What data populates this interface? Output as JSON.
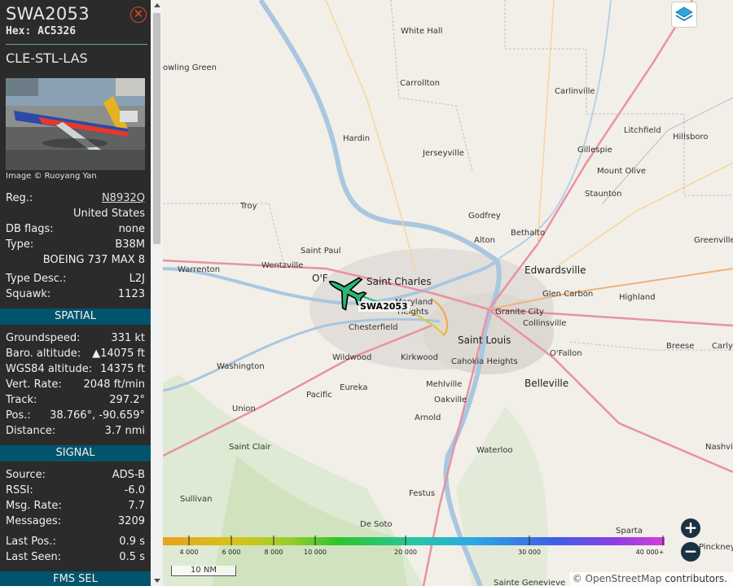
{
  "aircraft": {
    "callsign": "SWA2053",
    "hex_label": "Hex:",
    "hex": "AC5326",
    "route": "CLE-STL-LAS",
    "image_credit": "Image © Ruoyang Yan"
  },
  "details": {
    "reg_label": "Reg.:",
    "reg": "N8932Q",
    "country": "United States",
    "dbflags_label": "DB flags:",
    "dbflags": "none",
    "type_label": "Type:",
    "type": "B38M",
    "type_name": "BOEING 737 MAX 8",
    "typedesc_label": "Type Desc.:",
    "typedesc": "L2J",
    "squawk_label": "Squawk:",
    "squawk": "1123"
  },
  "spatial": {
    "header": "SPATIAL",
    "groundspeed_label": "Groundspeed:",
    "groundspeed": "331 kt",
    "baro_label": "Baro. altitude:",
    "baro_arrow": "▲",
    "baro": "14075 ft",
    "wgs84_label": "WGS84 altitude:",
    "wgs84": "14375 ft",
    "vrate_label": "Vert. Rate:",
    "vrate": "2048 ft/min",
    "track_label": "Track:",
    "track": "297.2°",
    "pos_label": "Pos.:",
    "pos": "38.766°, -90.659°",
    "distance_label": "Distance:",
    "distance": "3.7 nmi"
  },
  "signal": {
    "header": "SIGNAL",
    "source_label": "Source:",
    "source": "ADS-B",
    "rssi_label": "RSSI:",
    "rssi": "-6.0",
    "msgrate_label": "Msg. Rate:",
    "msgrate": "7.7",
    "messages_label": "Messages:",
    "messages": "3209",
    "lastpos_label": "Last Pos.:",
    "lastpos": "0.9 s",
    "lastseen_label": "Last Seen:",
    "lastseen": "0.5 s"
  },
  "fms": {
    "header": "FMS SEL"
  },
  "map": {
    "aircraft_label": "SWA2053",
    "zoom_in": "+",
    "zoom_out": "−",
    "scale": "10 NM",
    "attribution_osm": "© OpenStreetMap",
    "attribution_rest": " contributors.",
    "altitude_legend": [
      "4 000",
      "6 000",
      "8 000",
      "10 000",
      "20 000",
      "30 000",
      "40 000+"
    ],
    "places": {
      "white_hall": "White Hall",
      "bowling_green": "owling Green",
      "carrollton": "Carrollton",
      "carlinville": "Carlinville",
      "litchfield": "Litchfield",
      "hillsboro": "Hillsboro",
      "hardin": "Hardin",
      "jerseyville": "Jerseyville",
      "gillespie": "Gillespie",
      "mount_olive": "Mount Olive",
      "staunton": "Staunton",
      "troy": "Troy",
      "godfrey": "Godfrey",
      "bethalto": "Bethalto",
      "alton": "Alton",
      "greenville": "Greenville",
      "saint_paul": "Saint Paul",
      "warrenton": "Warrenton",
      "wentzville": "Wentzville",
      "ofallon_mo": "O'F",
      "saint_charles": "Saint Charles",
      "edwardsville": "Edwardsville",
      "maryland": "Maryland",
      "heights": "Heights",
      "glen_carbon": "Glen Carbon",
      "highland": "Highland",
      "granite_city": "Granite City",
      "collinsville": "Collinsville",
      "chesterfield": "Chesterfield",
      "saint_louis": "Saint Louis",
      "breese": "Breese",
      "carlyle": "Carly",
      "wildwood": "Wildwood",
      "kirkwood": "Kirkwood",
      "cahokia": "Cahokia Heights",
      "ofallon_il": "O'Fallon",
      "washington": "Washington",
      "belleville": "Belleville",
      "eureka": "Eureka",
      "mehlville": "Mehlville",
      "pacific": "Pacific",
      "oakville": "Oakville",
      "union": "Union",
      "arnold": "Arnold",
      "nashville": "Nashvil",
      "saint_clair": "Saint Clair",
      "waterloo": "Waterloo",
      "festus": "Festus",
      "sullivan": "Sullivan",
      "de_soto": "De Soto",
      "sparta": "Sparta",
      "pinckney": "Pinckney",
      "ste_genevieve": "Sainte Genevieve"
    }
  },
  "colors": {
    "sidebar_bg": "#2b2b2b",
    "section_bg": "#00546b",
    "close": "#e24a1c",
    "aircraft": "#2bb673",
    "map_bg": "#f2efe9"
  }
}
